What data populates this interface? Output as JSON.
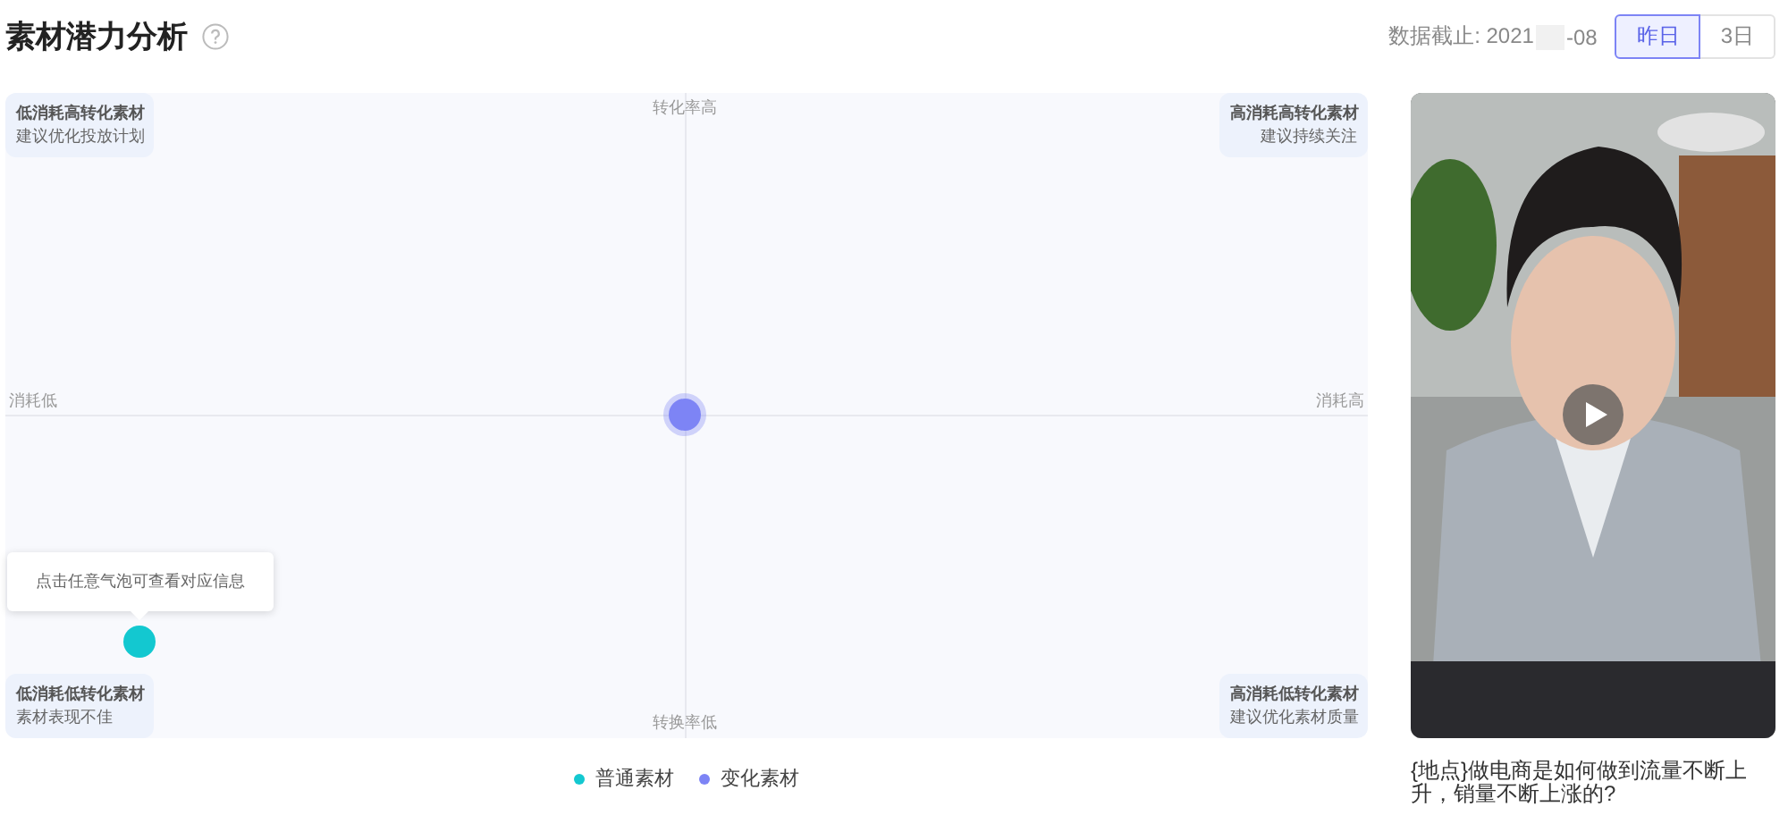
{
  "header": {
    "title": "素材潜力分析",
    "date_prefix": "数据截止: 2021",
    "date_suffix": "-08",
    "tabs": [
      {
        "label": "昨日",
        "selected": true
      },
      {
        "label": "3日",
        "selected": false
      }
    ]
  },
  "chart": {
    "quadrants": [
      {
        "title": "低消耗高转化素材",
        "hint": "建议优化投放计划"
      },
      {
        "title": "高消耗高转化素材",
        "hint": "建议持续关注"
      },
      {
        "title": "低消耗低转化素材",
        "hint": "素材表现不佳"
      },
      {
        "title": "高消耗低转化素材",
        "hint": "建议优化素材质量"
      }
    ],
    "axis_labels": {
      "top": "转化率高",
      "bottom": "转换率低",
      "left": "消耗低",
      "right": "消耗高"
    },
    "tooltip": "点击任意气泡可查看对应信息",
    "legend": [
      {
        "label": "普通素材",
        "color": "#13c8d0"
      },
      {
        "label": "变化素材",
        "color": "#7d84f5"
      }
    ]
  },
  "video": {
    "kind": "picture",
    "caption": "{地点}做电商是如何做到流量不断上升，销量不断上涨的?"
  }
}
